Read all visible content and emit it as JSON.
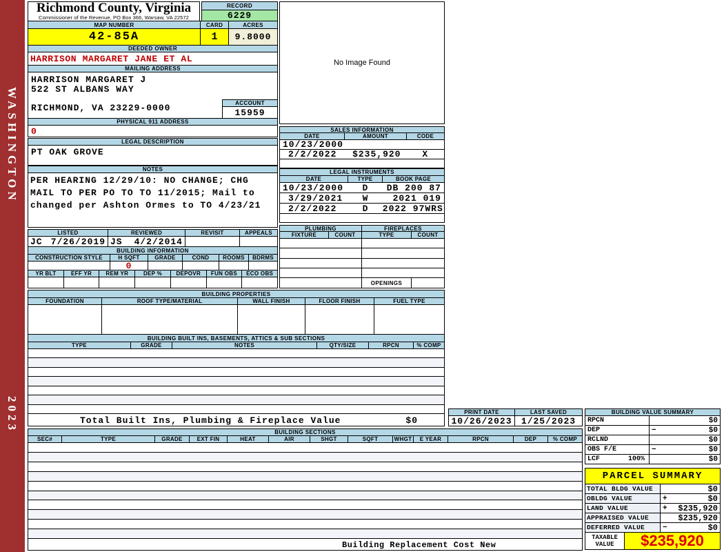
{
  "sidebar": {
    "district": "WASHINGTON",
    "year": "2023"
  },
  "header": {
    "county_title": "Richmond County, Virginia",
    "county_subtitle": "Commissioner of the Revenue, PO Box 366, Warsaw, VA 22572",
    "record_label": "RECORD",
    "record_value": "6229",
    "map_number_label": "MAP NUMBER",
    "map_number": "42-85A",
    "card_label": "CARD",
    "card": "1",
    "acres_label": "ACRES",
    "acres": "9.8000"
  },
  "owner": {
    "label": "DEEDED OWNER",
    "name": "HARRISON MARGARET JANE ET AL"
  },
  "mailing": {
    "label": "MAILING ADDRESS",
    "line1": "HARRISON MARGARET J",
    "line2": "522 ST ALBANS WAY",
    "line3": "RICHMOND, VA 23229-0000"
  },
  "account": {
    "label": "ACCOUNT",
    "value": "15959"
  },
  "physical_address": {
    "label": "PHYSICAL 911 ADDRESS",
    "value": "0"
  },
  "legal_description": {
    "label": "LEGAL DESCRIPTION",
    "value": "PT OAK GROVE"
  },
  "notes": {
    "label": "NOTES",
    "line1": "PER HEARING 12/29/10: NO CHANGE; CHG",
    "line2": "MAIL TO PER PO TO TO 11/2015; Mail to",
    "line3": "changed per Ashton Ormes to TO 4/23/21"
  },
  "review": {
    "listed_label": "LISTED",
    "listed_by": "JC",
    "listed_date": "7/26/2019",
    "reviewed_label": "REVIEWED",
    "reviewed_by": "JS",
    "reviewed_date": "4/2/2014",
    "revisit_label": "REVISIT",
    "appeals_label": "APPEALS"
  },
  "building_information": {
    "title": "BUILDING INFORMATION",
    "row1_headers": [
      "CONSTRUCTION STYLE",
      "H SQFT",
      "GRADE",
      "COND",
      "ROOMS",
      "BDRMS"
    ],
    "h_sqft": "0",
    "row2_headers": [
      "YR BLT",
      "EFF YR",
      "REM YR",
      "DEP %",
      "DEPOVR",
      "FUN OBS",
      "ECO OBS"
    ]
  },
  "image_panel": {
    "text": "No Image Found"
  },
  "sales": {
    "title": "SALES INFORMATION",
    "headers": [
      "DATE",
      "AMOUNT",
      "CODE"
    ],
    "rows": [
      [
        "10/23/2000",
        "",
        ""
      ],
      [
        "2/2/2022",
        "$235,920",
        "X"
      ]
    ]
  },
  "legal_instruments": {
    "title": "LEGAL INSTRUMENTS",
    "headers": [
      "DATE",
      "TYPE",
      "BOOK PAGE"
    ],
    "rows": [
      [
        "10/23/2000",
        "D",
        "DB 200 87"
      ],
      [
        "3/29/2021",
        "W",
        "2021 019"
      ],
      [
        "2/2/2022",
        "D",
        "2022 97WRS"
      ]
    ]
  },
  "plumbing": {
    "title": "PLUMBING",
    "headers": [
      "FIXTURE",
      "COUNT"
    ]
  },
  "fireplaces": {
    "title": "FIREPLACES",
    "headers": [
      "TYPE",
      "COUNT"
    ],
    "openings_label": "OPENINGS"
  },
  "building_properties": {
    "title": "BUILDING PROPERTIES",
    "headers": [
      "FOUNDATION",
      "ROOF TYPE/MATERIAL",
      "WALL FINISH",
      "FLOOR FINISH",
      "FUEL TYPE"
    ]
  },
  "built_ins": {
    "title": "BUILDING BUILT INS, BASEMENTS, ATTICS & SUB SECTIONS",
    "headers": [
      "TYPE",
      "GRADE",
      "NOTES",
      "QTY/SIZE",
      "RPCN",
      "% COMP"
    ],
    "total_label": "Total Built Ins, Plumbing & Fireplace Value",
    "total_value": "$0"
  },
  "print_info": {
    "print_date_label": "PRINT DATE",
    "print_date": "10/26/2023",
    "last_saved_label": "LAST SAVED",
    "last_saved": "1/25/2023"
  },
  "building_sections": {
    "title": "BUILDING SECTIONS",
    "headers": [
      "SEC#",
      "TYPE",
      "GRADE",
      "EXT FIN",
      "HEAT",
      "AIR",
      "SHGT",
      "SQFT",
      "WHGT",
      "E YEAR",
      "RPCN",
      "DEP",
      "% COMP"
    ],
    "footer": "Building Replacement Cost New"
  },
  "building_value_summary": {
    "title": "BUILDING VALUE SUMMARY",
    "rows": [
      {
        "label": "RPCN",
        "pct": "",
        "op": "",
        "value": "$0"
      },
      {
        "label": "DEP",
        "pct": "",
        "op": "−",
        "value": "$0"
      },
      {
        "label": "RCLND",
        "pct": "",
        "op": "",
        "value": "$0"
      },
      {
        "label": "OBS F/E",
        "pct": "",
        "op": "−",
        "value": "$0"
      },
      {
        "label": "LCF",
        "pct": "100%",
        "op": "",
        "value": "$0"
      }
    ]
  },
  "parcel_summary": {
    "title": "PARCEL SUMMARY",
    "rows": [
      {
        "label": "TOTAL BLDG VALUE",
        "op": "",
        "value": "$0"
      },
      {
        "label": "OBLDG VALUE",
        "op": "+",
        "value": "$0"
      },
      {
        "label": "LAND VALUE",
        "op": "+",
        "value": "$235,920"
      },
      {
        "label": "APPRAISED VALUE",
        "op": "",
        "value": "$235,920"
      },
      {
        "label": "DEFERRED VALUE",
        "op": "−",
        "value": "$0"
      }
    ],
    "taxable_label_line1": "TAXABLE",
    "taxable_label_line2": "VALUE",
    "taxable_value": "$235,920"
  },
  "colors": {
    "sidebar_red": "#A03030",
    "header_blue": "#B4D7E6",
    "highlight_yellow": "#FFFF00",
    "record_green": "#A4E6A4",
    "acres_cream": "#F2EFD9",
    "alert_red": "#C00000",
    "taxable_red": "#DD0000"
  }
}
